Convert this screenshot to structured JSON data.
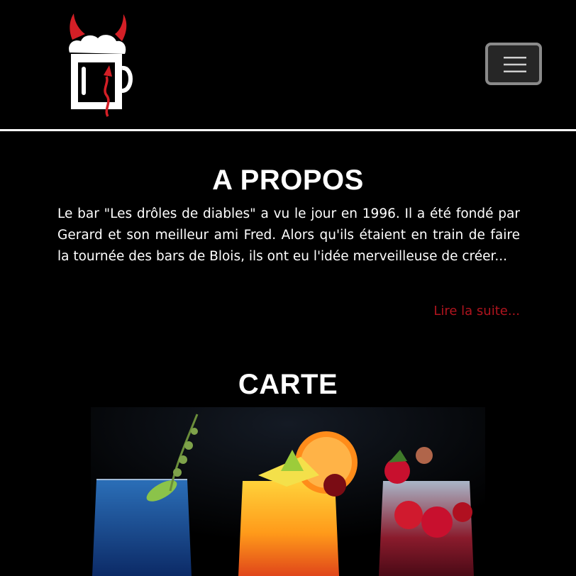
{
  "header": {
    "logo_icon": "devil-beer-mug-logo",
    "menu_icon": "hamburger-menu-icon"
  },
  "about": {
    "title": "A PROPOS",
    "text": "Le bar \"Les drôles de diables\" a vu le jour en 1996. Il a été fondé par Gerard et son meilleur ami Fred. Alors qu'ils étaient en train de faire la tournée des bars de Blois, ils ont eu l'idée merveilleuse de créer...",
    "read_more": "Lire la suite..."
  },
  "menu_section": {
    "title": "CARTE",
    "photo": "three-cocktails-photo"
  },
  "colors": {
    "background": "#000000",
    "accent_red": "#b0141e",
    "logo_red": "#d41f26"
  }
}
